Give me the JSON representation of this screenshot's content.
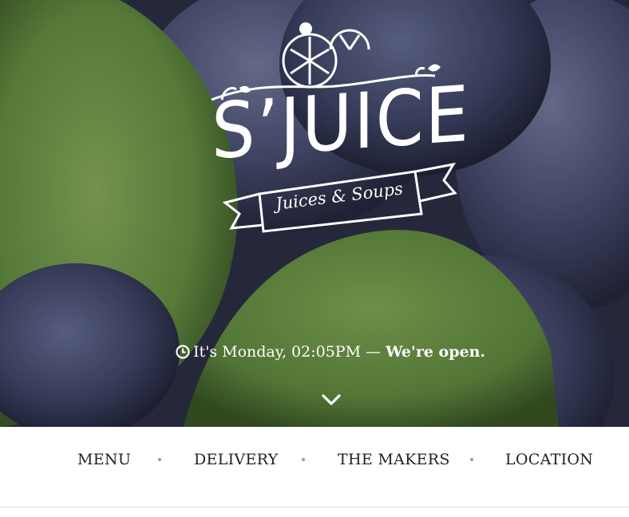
{
  "hero": {
    "logo_title": "S’JUICE",
    "logo_subtitle": "Juices & Soups"
  },
  "status": {
    "icon": "clock-icon",
    "text": "It's Monday, 02:05PM",
    "separator": "—",
    "open_text": "We're open."
  },
  "scroll": {
    "icon": "chevron-down-icon"
  },
  "nav": {
    "items": [
      {
        "label": "MENU"
      },
      {
        "label": "DELIVERY"
      },
      {
        "label": "THE MAKERS"
      },
      {
        "label": "LOCATION"
      }
    ]
  },
  "colors": {
    "leaf_green": "#6f9a4a",
    "berry_blue": "#3d4466",
    "text_dark": "#222222",
    "white": "#ffffff"
  }
}
